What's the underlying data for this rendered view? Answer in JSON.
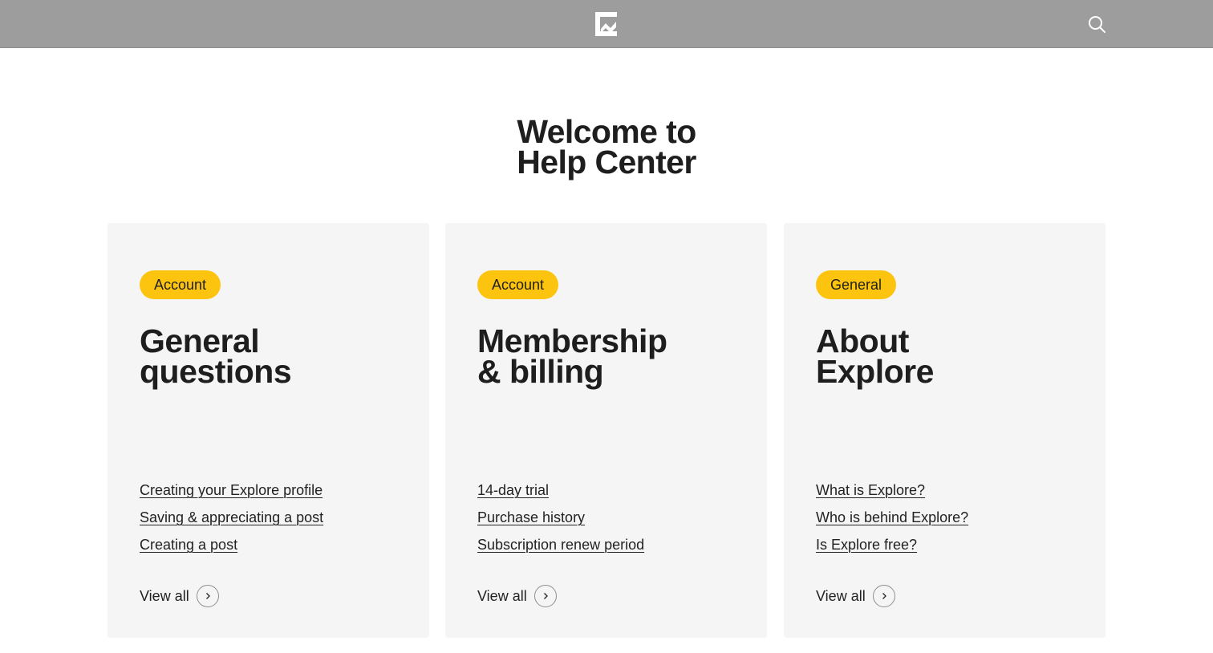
{
  "header": {
    "logo_icon": "explore-logo-icon",
    "search_icon": "search-icon"
  },
  "hero": {
    "line1": "Welcome to",
    "line2": "Help Center"
  },
  "colors": {
    "topbar": "#9d9d9d",
    "badge": "#fdc40f",
    "card_background": "#f5f5f5"
  },
  "cards": [
    {
      "badge": "Account",
      "title_line1": "General",
      "title_line2": "questions",
      "links": [
        "Creating your Explore profile",
        "Saving & appreciating a post",
        "Creating a post"
      ],
      "view_all": "View all"
    },
    {
      "badge": "Account",
      "title_line1": "Membership",
      "title_line2": "& billing",
      "links": [
        "14-day trial",
        "Purchase history",
        "Subscription renew period"
      ],
      "view_all": "View all"
    },
    {
      "badge": "General",
      "title_line1": "About",
      "title_line2": "Explore",
      "links": [
        "What is Explore?",
        "Who is behind Explore?",
        "Is Explore free?"
      ],
      "view_all": "View all"
    }
  ]
}
